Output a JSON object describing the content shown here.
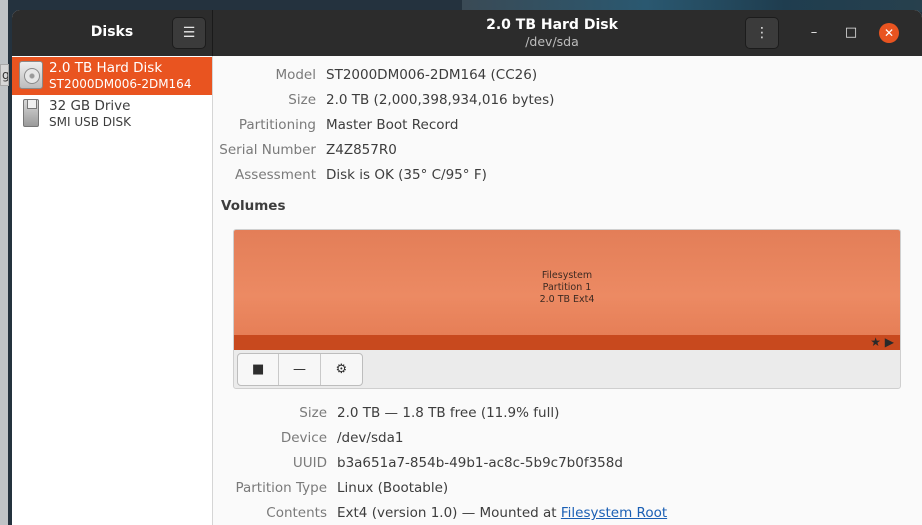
{
  "window": {
    "app_title": "Disks",
    "disk_title": "2.0 TB Hard Disk",
    "disk_subtitle": "/dev/sda",
    "app_menu_icon": "hamburger-menu-icon",
    "disk_menu_icon": "vertical-dots-icon"
  },
  "background": {
    "partial_label": "g"
  },
  "sidebar": {
    "items": [
      {
        "name": "2.0 TB Hard Disk",
        "model": "ST2000DM006-2DM164",
        "icon": "hard-disk-icon",
        "selected": true
      },
      {
        "name": "32 GB Drive",
        "model": "SMI USB DISK",
        "icon": "usb-drive-icon",
        "selected": false
      }
    ]
  },
  "disk_info": {
    "model_label": "Model",
    "model": "ST2000DM006-2DM164 (CC26)",
    "size_label": "Size",
    "size": "2.0 TB (2,000,398,934,016 bytes)",
    "partitioning_label": "Partitioning",
    "partitioning": "Master Boot Record",
    "serial_label": "Serial Number",
    "serial": "Z4Z857R0",
    "assessment_label": "Assessment",
    "assessment": "Disk is OK (35° C/95° F)"
  },
  "volumes": {
    "title": "Volumes",
    "partition": {
      "line1": "Filesystem",
      "line2": "Partition 1",
      "line3": "2.0 TB Ext4",
      "flags": "★ ▶"
    },
    "toolbar": {
      "stop_icon": "stop-icon",
      "delete_icon": "minus-icon",
      "options_icon": "gears-icon"
    }
  },
  "partition_info": {
    "size_label": "Size",
    "size": "2.0 TB — 1.8 TB free (11.9% full)",
    "device_label": "Device",
    "device": "/dev/sda1",
    "uuid_label": "UUID",
    "uuid": "b3a651a7-854b-49b1-ac8c-5b9c7b0f358d",
    "type_label": "Partition Type",
    "type": "Linux (Bootable)",
    "contents_label": "Contents",
    "contents_prefix": "Ext4 (version 1.0) — Mounted at ",
    "contents_link": "Filesystem Root"
  },
  "colors": {
    "accent": "#e95420",
    "headerbar": "#2c2c2c",
    "partition_fill": "#ec8a63",
    "partition_bar": "#c8491e",
    "link": "#1a5fb4"
  }
}
